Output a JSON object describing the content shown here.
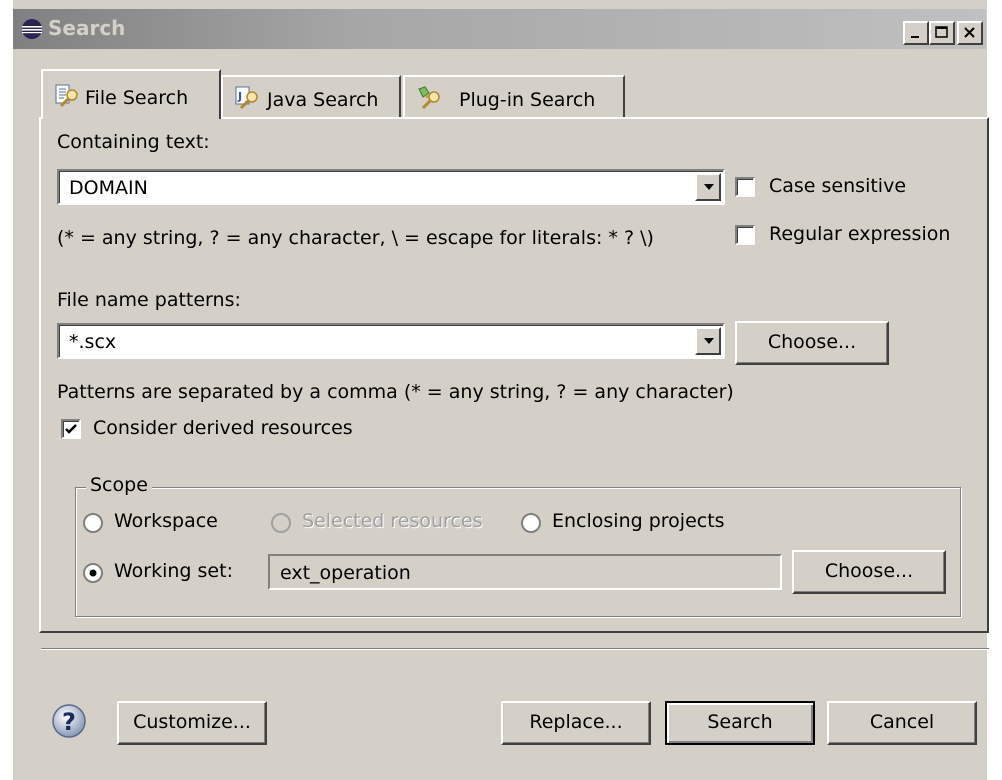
{
  "window": {
    "title": "Search",
    "icon": "eclipse-icon",
    "controls": [
      "minimize-icon",
      "maximize-icon",
      "close-icon"
    ]
  },
  "tabs": [
    {
      "label": "File Search",
      "icon": "file-search-icon",
      "active": true
    },
    {
      "label": "Java Search",
      "icon": "java-search-icon",
      "active": false
    },
    {
      "label": "Plug-in Search",
      "icon": "plugin-search-icon",
      "active": false
    }
  ],
  "file_search": {
    "containing_text_label": "Containing text:",
    "containing_text_value": "DOMAIN",
    "case_sensitive_label": "Case sensitive",
    "case_sensitive_checked": false,
    "regex_label": "Regular expression",
    "regex_checked": false,
    "hint": "(* = any string, ? = any character, \\ = escape for literals: * ? \\)",
    "file_name_patterns_label": "File name patterns:",
    "file_name_patterns_value": "*.scx",
    "choose_label": "Choose...",
    "patterns_hint": "Patterns are separated by a comma (* = any string, ? = any character)",
    "consider_derived_label": "Consider derived resources",
    "consider_derived_checked": true
  },
  "scope": {
    "label": "Scope",
    "workspace_label": "Workspace",
    "selected_resources_label": "Selected resources",
    "enclosing_projects_label": "Enclosing projects",
    "working_set_label": "Working set:",
    "working_set_value": "ext_operation",
    "choose_label": "Choose...",
    "selected": "Working set:"
  },
  "footer": {
    "help_icon": "help-icon",
    "customize_label": "Customize...",
    "replace_label": "Replace...",
    "search_label": "Search",
    "cancel_label": "Cancel"
  }
}
